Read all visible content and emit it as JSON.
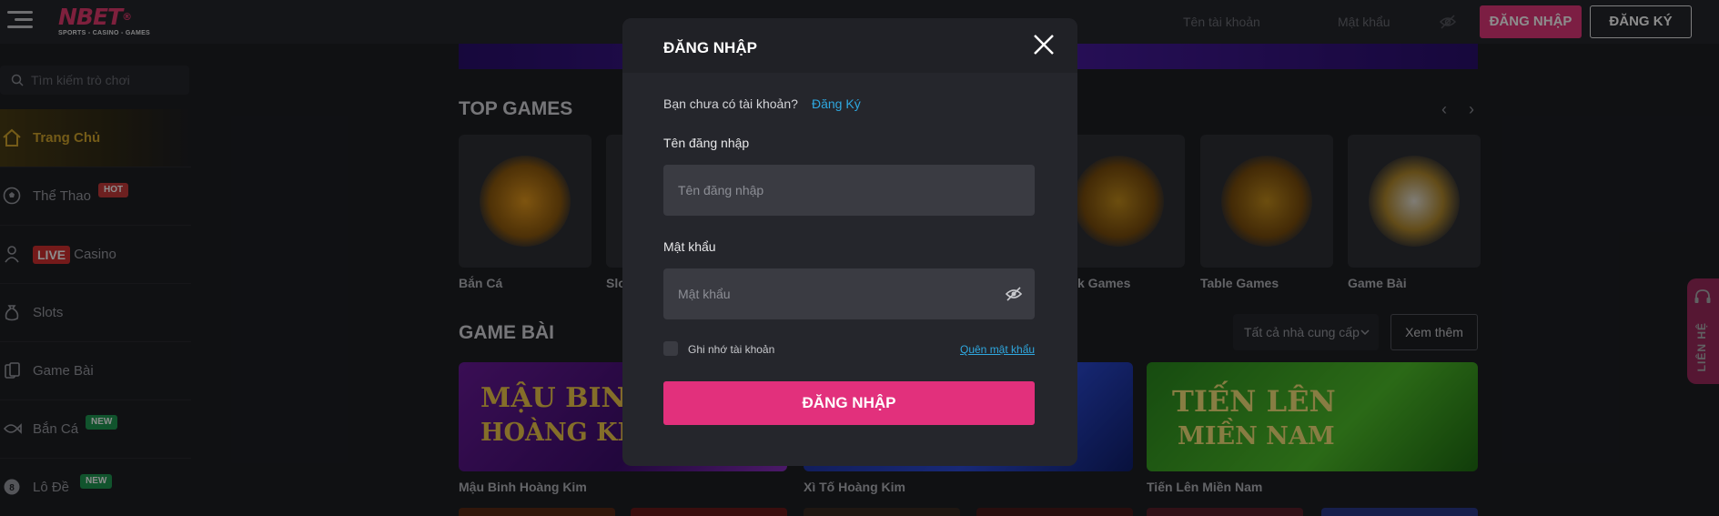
{
  "header": {
    "logo": "NBET",
    "logo_reg": "®",
    "logo_tagline": "SPORTS - CASINO - GAMES",
    "username_placeholder": "Tên tài khoản",
    "password_placeholder": "Mật khẩu",
    "login_label": "ĐĂNG NHẬP",
    "register_label": "ĐĂNG KÝ"
  },
  "sidebar": {
    "search_placeholder": "Tìm kiếm trò chơi",
    "items": [
      {
        "label": "Trang Chủ",
        "icon": "home-icon",
        "active": true
      },
      {
        "label": "Thể Thao",
        "icon": "soccer-ball-icon",
        "badge": "HOT"
      },
      {
        "label": "Casino",
        "icon": "dealer-icon",
        "prefix": "LIVE"
      },
      {
        "label": "Slots",
        "icon": "money-bag-icon"
      },
      {
        "label": "Game Bài",
        "icon": "cards-icon"
      },
      {
        "label": "Bắn Cá",
        "icon": "fish-icon",
        "badge": "NEW"
      },
      {
        "label": "Lô Đề",
        "icon": "lottery-ball-icon",
        "badge": "NEW"
      }
    ]
  },
  "main": {
    "top_games_title": "TOP GAMES",
    "top_games": [
      {
        "label": "Bắn Cá"
      },
      {
        "label": "Slo"
      },
      {
        "label": "k Games"
      },
      {
        "label": "Table Games"
      },
      {
        "label": "Game Bài"
      }
    ],
    "game_bai_title": "GAME BÀI",
    "provider_select": "Tất cả nhà cung cấp",
    "more_label": "Xem thêm",
    "game_bai_cards": [
      {
        "label": "Mậu Binh Hoàng Kim",
        "art_line1": "MẬU BINH",
        "art_line2": "HOÀNG KIM"
      },
      {
        "label": "Xì Tố Hoàng Kim"
      },
      {
        "label": "Tiến Lên Miền Nam",
        "art_line1": "TIẾN LÊN",
        "art_line2": "MIỀN NAM"
      }
    ]
  },
  "login_modal": {
    "title": "ĐĂNG NHẬP",
    "prompt": "Bạn chưa có tài khoản?",
    "register_link": "Đăng Ký",
    "username_label": "Tên đăng nhập",
    "username_placeholder": "Tên đăng nhập",
    "password_label": "Mật khẩu",
    "password_placeholder": "Mật khẩu",
    "remember_label": "Ghi nhớ tài khoản",
    "remember_checked": false,
    "forgot_label": "Quên mật khẩu",
    "submit_label": "ĐĂNG NHẬP"
  },
  "contact": {
    "label": "LIÊN HỆ"
  },
  "colors": {
    "accent": "#e2307c",
    "active_nav": "#d4a72c",
    "link": "#2fa8e0",
    "background": "#1e1f24"
  }
}
